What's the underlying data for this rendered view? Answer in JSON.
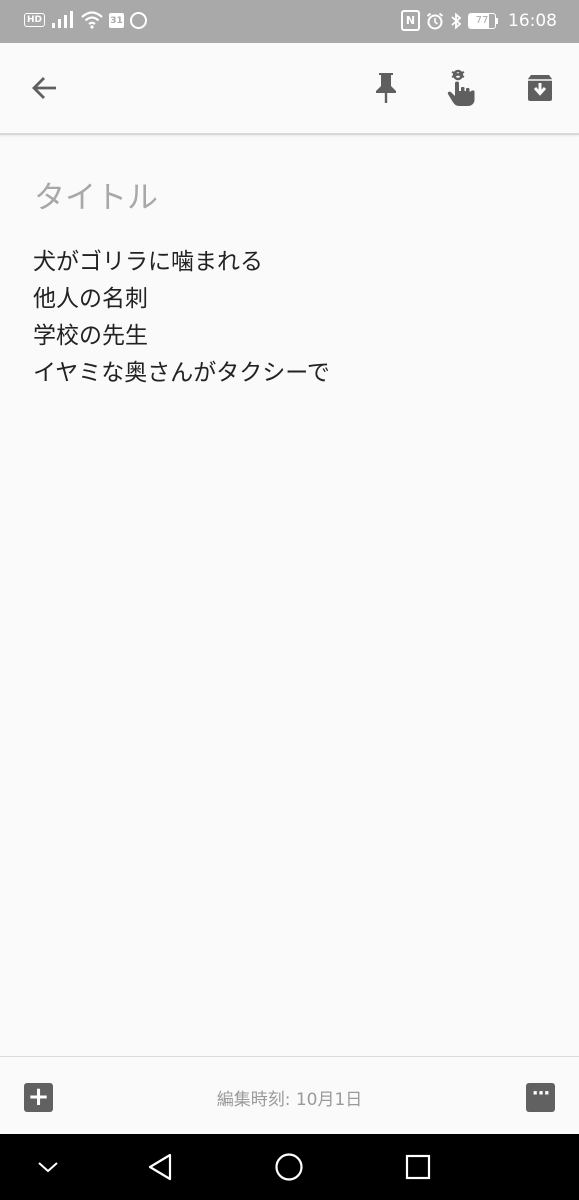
{
  "status_bar": {
    "hd_label": "HD",
    "calendar_day": "31",
    "nfc_label": "N",
    "battery_level": "77",
    "battery_fraction": 0.77,
    "time": "16:08",
    "background_color": "#a9a9a9"
  },
  "toolbar": {
    "back_icon": "arrow-left-icon",
    "pin_icon": "pin-icon",
    "reminder_icon": "reminder-hand-icon",
    "archive_icon": "archive-icon"
  },
  "note": {
    "title_placeholder": "タイトル",
    "lines": [
      "犬がゴリラに噛まれる",
      "他人の名刺",
      "学校の先生",
      "イヤミな奥さんがタクシーで"
    ]
  },
  "bottom_bar": {
    "add_label": "+",
    "edited_text": "編集時刻: 10月1日",
    "more_label": "···"
  },
  "nav_bar": {
    "hide_icon": "chevron-down-icon",
    "back_icon": "triangle-back-icon",
    "home_icon": "circle-home-icon",
    "recent_icon": "square-recent-icon"
  }
}
